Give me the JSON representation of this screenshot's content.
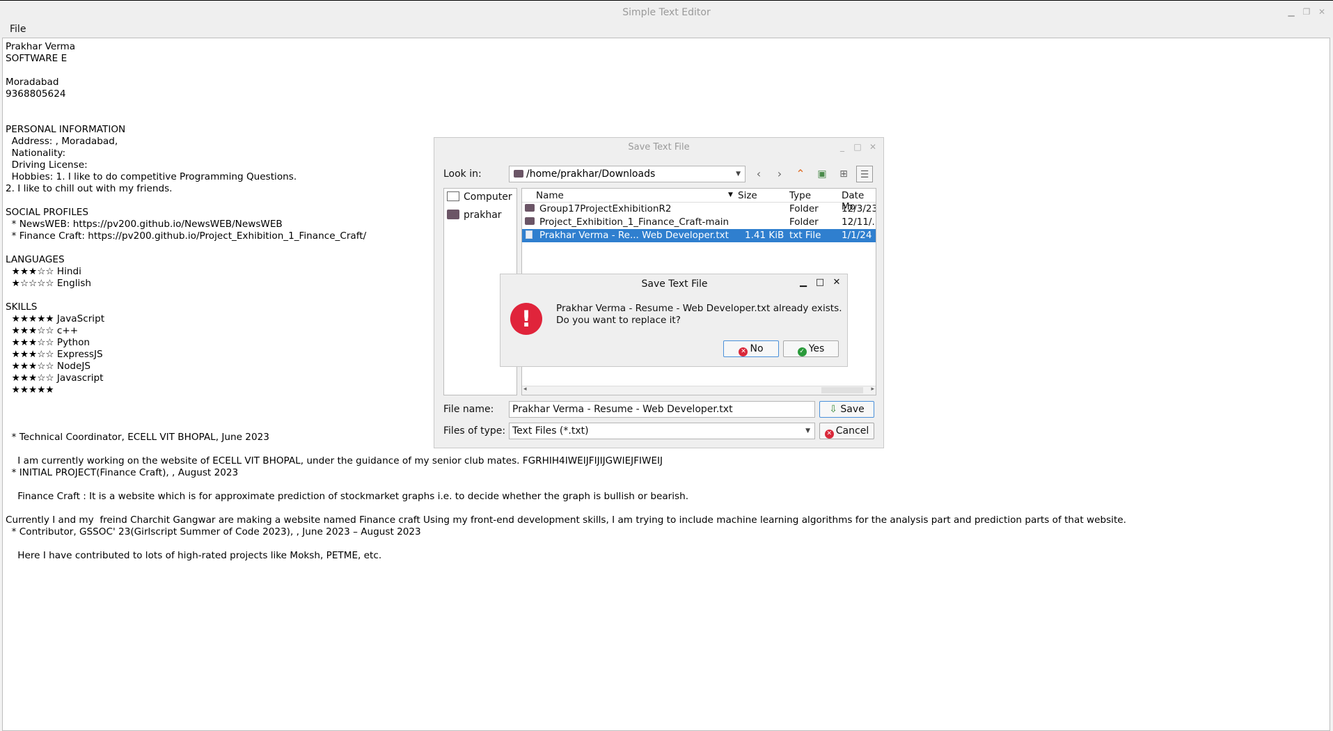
{
  "window": {
    "title": "Simple Text Editor",
    "controls": [
      "_",
      "□",
      "✕"
    ]
  },
  "menu": {
    "file": "File"
  },
  "editor": {
    "text": "Prakhar Verma\nSOFTWARE E\n\nMoradabad\n9368805624\n\n\nPERSONAL INFORMATION\n  Address: , Moradabad,\n  Nationality:\n  Driving License:\n  Hobbies: 1. I like to do competitive Programming Questions.\n2. I like to chill out with my friends.\n\nSOCIAL PROFILES\n  * NewsWEB: https://pv200.github.io/NewsWEB/NewsWEB\n  * Finance Craft: https://pv200.github.io/Project_Exhibition_1_Finance_Craft/\n\nLANGUAGES\n  ★★★☆☆ Hindi\n  ★☆☆☆☆ English\n\nSKILLS\n  ★★★★★ JavaScript\n  ★★★☆☆ c++\n  ★★★☆☆ Python\n  ★★★☆☆ ExpressJS\n  ★★★☆☆ NodeJS\n  ★★★☆☆ Javascript\n  ★★★★★\n\n\n\n  * Technical Coordinator, ECELL VIT BHOPAL, June 2023\n\n    I am currently working on the website of ECELL VIT BHOPAL, under the guidance of my senior club mates. FGRHIH4IWEIJFIJIJGWIEJFIWEIJ\n  * INITIAL PROJECT(Finance Craft), , August 2023\n\n    Finance Craft : It is a website which is for approximate prediction of stockmarket graphs i.e. to decide whether the graph is bullish or bearish.\n\nCurrently I and my  freind Charchit Gangwar are making a website named Finance craft Using my front-end development skills, I am trying to include machine learning algorithms for the analysis part and prediction parts of that website.\n  * Contributor, GSSOC' 23(Girlscript Summer of Code 2023), , June 2023 – August 2023\n\n    Here I have contributed to lots of high-rated projects like Moksh, PETME, etc."
  },
  "save_dialog": {
    "title": "Save Text File",
    "look_in_label": "Look in:",
    "path": "/home/prakhar/Downloads",
    "places": [
      "Computer",
      "prakhar"
    ],
    "columns": [
      "Name",
      "Size",
      "Type",
      "Date Mo"
    ],
    "files": [
      {
        "name": "Group17ProjectExhibitionR2",
        "size": "",
        "type": "Folder",
        "date": "12/3/23",
        "selected": false
      },
      {
        "name": "Project_Exhibition_1_Finance_Craft-main",
        "size": "",
        "type": "Folder",
        "date": "12/11/.",
        "selected": false
      },
      {
        "name": "Prakhar Verma - Re... Web Developer.txt",
        "size": "1.41 KiB",
        "type": "txt File",
        "date": "1/1/24",
        "selected": true
      }
    ],
    "file_name_label": "File name:",
    "file_name_value": "Prakhar Verma - Resume - Web Developer.txt",
    "file_type_label": "Files of type:",
    "file_type_value": "Text Files (*.txt)",
    "save_button": "Save",
    "cancel_button": "Cancel"
  },
  "confirm": {
    "title": "Save Text File",
    "line1": "Prakhar Verma - Resume - Web Developer.txt already exists.",
    "line2": "Do you want to replace it?",
    "no_button": "No",
    "yes_button": "Yes"
  }
}
